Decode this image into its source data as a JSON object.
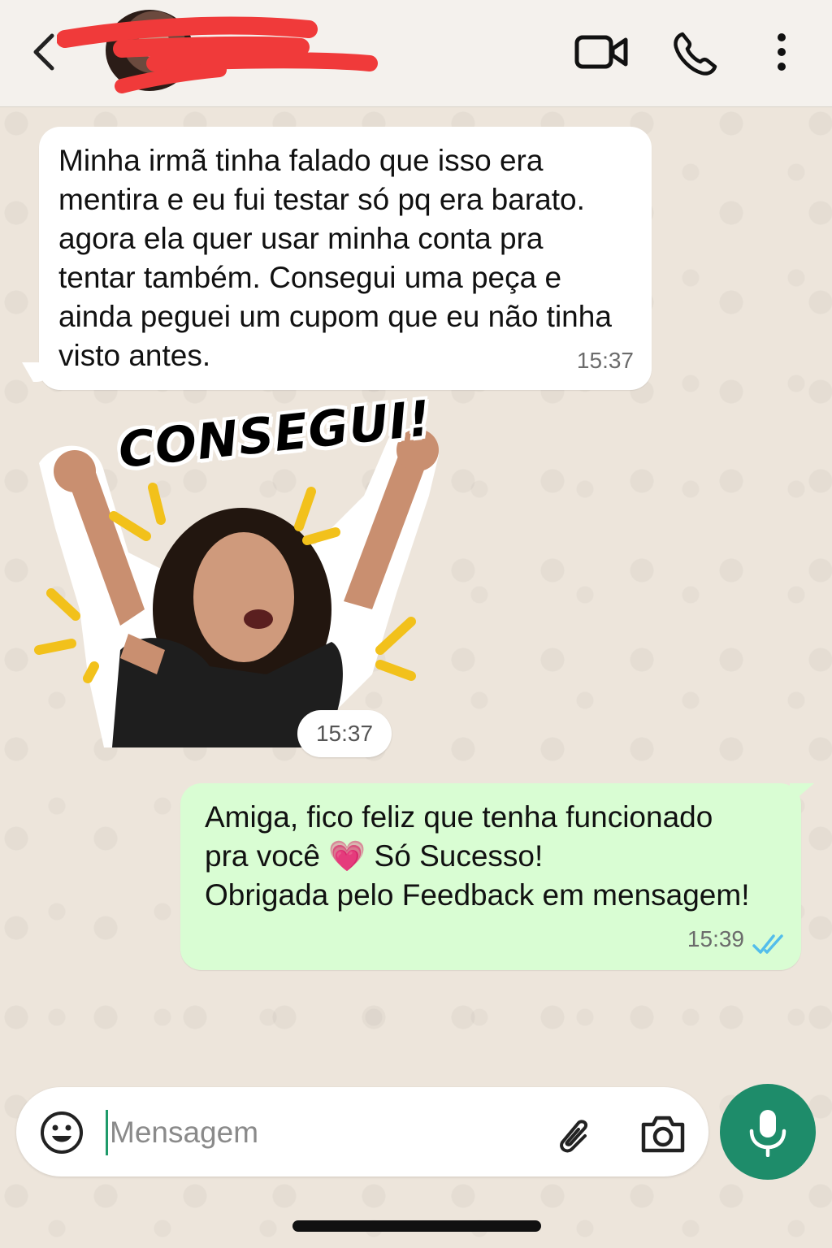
{
  "header": {
    "contact_name": "",
    "icons": [
      "back-chevron-icon",
      "video-call-icon",
      "phone-call-icon",
      "more-options-icon"
    ]
  },
  "messages": [
    {
      "direction": "incoming",
      "text": "Minha irmã tinha falado que isso era\nmentira e eu fui testar só pq era barato.\nagora ela quer usar minha conta pra\ntentar também. Consegui uma peça e\nainda peguei um cupom que eu não tinha\nvisto antes.",
      "time": "15:37"
    },
    {
      "direction": "incoming",
      "type": "sticker",
      "sticker_text": "CONSEGUI!",
      "time": "15:37"
    },
    {
      "direction": "outgoing",
      "text": "Amiga, fico feliz que tenha funcionado\npra você 💗 Só Sucesso!\nObrigada pelo Feedback em mensagem!",
      "time": "15:39",
      "status": "read"
    }
  ],
  "composer": {
    "placeholder": "Mensagem",
    "value": "",
    "icons": [
      "emoji-icon",
      "paperclip-icon",
      "camera-icon",
      "microphone-icon"
    ]
  },
  "colors": {
    "outgoing_bubble": "#d9fdd3",
    "incoming_bubble": "#ffffff",
    "accent_green": "#1e8c6a",
    "read_ticks": "#53bdeb",
    "background": "#efe7dd"
  }
}
